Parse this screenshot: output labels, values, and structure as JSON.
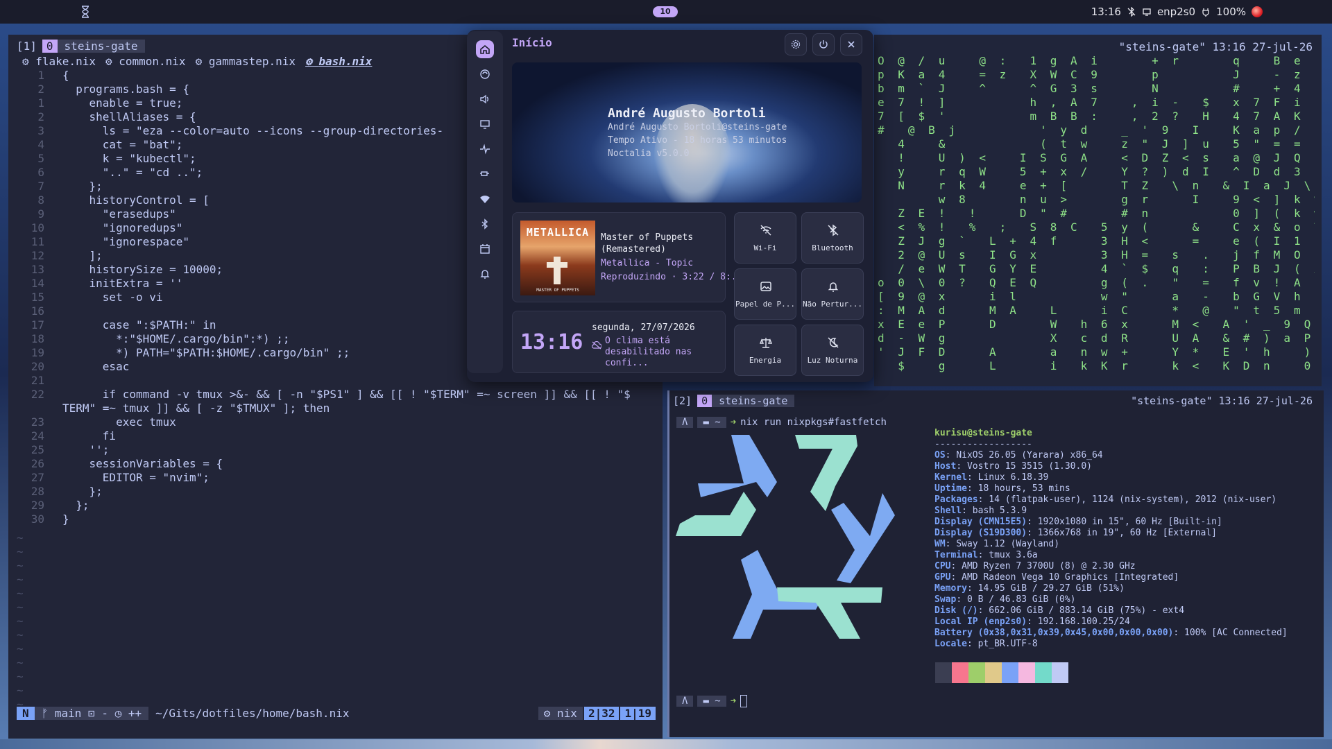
{
  "topbar": {
    "workspace": "10",
    "time": "13:16",
    "network": "enp2s0",
    "battery": "100%"
  },
  "left_pane": {
    "tmux_index": "[1]",
    "tmux_num": "0",
    "tmux_name": "steins-gate",
    "buffers": [
      "flake.nix",
      "common.nix",
      "gammastep.nix",
      "bash.nix"
    ],
    "code": [
      {
        "ln": "1",
        "text": "{"
      },
      {
        "ln": "2",
        "text": "  programs.bash = {"
      },
      {
        "ln": "1",
        "text": "    enable = true;"
      },
      {
        "ln": "2",
        "text": "    shellAliases = {"
      },
      {
        "ln": "3",
        "text": "      ls = \"eza --color=auto --icons --group-directories-"
      },
      {
        "ln": "4",
        "text": "      cat = \"bat\";"
      },
      {
        "ln": "5",
        "text": "      k = \"kubectl\";"
      },
      {
        "ln": "6",
        "text": "      \"..\" = \"cd ..\";"
      },
      {
        "ln": "7",
        "text": "    };"
      },
      {
        "ln": "8",
        "text": "    historyControl = ["
      },
      {
        "ln": "9",
        "text": "      \"erasedups\""
      },
      {
        "ln": "10",
        "text": "      \"ignoredups\""
      },
      {
        "ln": "11",
        "text": "      \"ignorespace\""
      },
      {
        "ln": "12",
        "text": "    ];"
      },
      {
        "ln": "13",
        "text": "    historySize = 10000;"
      },
      {
        "ln": "14",
        "text": "    initExtra = ''"
      },
      {
        "ln": "15",
        "text": "      set -o vi"
      },
      {
        "ln": "16",
        "text": ""
      },
      {
        "ln": "17",
        "text": "      case \":$PATH:\" in"
      },
      {
        "ln": "18",
        "text": "        *:\"$HOME/.cargo/bin\":*) ;;"
      },
      {
        "ln": "19",
        "text": "        *) PATH=\"$PATH:$HOME/.cargo/bin\" ;;"
      },
      {
        "ln": "20",
        "text": "      esac"
      },
      {
        "ln": "21",
        "text": ""
      },
      {
        "ln": "22",
        "text": "      if command -v tmux >&- && [ -n \"$PS1\" ] && [[ ! \"$TERM\" =~ screen ]] && [[ ! \"$"
      },
      {
        "ln": "",
        "text": "TERM\" =~ tmux ]] && [ -z \"$TMUX\" ]; then"
      },
      {
        "ln": "23",
        "text": "        exec tmux"
      },
      {
        "ln": "24",
        "text": "      fi"
      },
      {
        "ln": "25",
        "text": "    '';"
      },
      {
        "ln": "26",
        "text": "    sessionVariables = {"
      },
      {
        "ln": "27",
        "text": "      EDITOR = \"nvim\";"
      },
      {
        "ln": "28",
        "text": "    };"
      },
      {
        "ln": "29",
        "text": "  };"
      },
      {
        "ln": "30",
        "text": "}"
      }
    ],
    "status": {
      "mode": "N",
      "branch": "main",
      "branch_extra": "⊡ - ◷ ++",
      "path": "~/Gits/dotfiles/home/bash.nix",
      "filetype": "nix",
      "pos1": "2|32",
      "pos2": "1|19"
    }
  },
  "top_right": {
    "title": "\"steins-gate\" 13:16 27-jul-26",
    "matrix": [
      "O @ / u   @ :  1 g A i     + r     q   B e",
      "p K a 4   = z  X W C 9     p       J   - z",
      "b m ` J   ^    ^ G 3 s     N       #   + 4",
      "e 7 ! ]        h , A 7   , i -  $  x 7 F i",
      "7 [ $ '        m B B :   , 2 ?  H  4 7 A K",
      "#  @ B j        ' y d   _ ' 9  I   K a p /",
      "  4   &         ( t w   z \" J ] u  5 \" = =",
      "  !   U ) <   I S G A   < D Z < s  a @ J Q u",
      "  y   r q W   5 + x /   Y ? ) d I  ^ D d 3 K &",
      "  N   r k 4   e + [     T Z  \\ n  & I a J \\ o",
      "      w 8     n u >     g r    I   9 < ] k % R",
      "  Z E !  !    D \" #     # n        0 ] ( k w O",
      "  < % !  %  ;  S 8 C  5 y (    &   C x & o T J",
      "  Z J g `  L + 4 f    3 H <    =   e ( I 1 f",
      "  2 @ U s  I G x      3 H =  s  .  j f M O z",
      "  / e W T  G Y E      4 ` $  q  :  P B J ( X Z",
      "o 0 \\ 0 ?  Q E Q      g ( .  \"  =  f v ! A m",
      "[ 9 @ x    i l        w \"    a  -  b G V h u -",
      ": M A d    M A   L    i C    *  @  \" t 5 m F x",
      "x E e P    D     W  h 6 x    M <  A ' _ 9 Q U W",
      "d - W g          X  c d R    U A  & # ) a P *",
      "' J F D    A     a  n w +    Y *  E ' h   )   x",
      "  $   g    L     i  k K r    k <  K D n   0   o"
    ]
  },
  "bottom_right": {
    "tmux_index": "[2]",
    "tmux_num": "0",
    "tmux_name": "steins-gate",
    "title": "\"steins-gate\" 13:16 27-jul-26",
    "prompt_dir": "~",
    "command": "nix run nixpkgs#fastfetch",
    "user_host": "kurisu@steins-gate",
    "divider": "------------------",
    "info": [
      {
        "k": "OS",
        "v": "NixOS 26.05 (Yarara) x86_64"
      },
      {
        "k": "Host",
        "v": "Vostro 15 3515 (1.30.0)"
      },
      {
        "k": "Kernel",
        "v": "Linux 6.18.39"
      },
      {
        "k": "Uptime",
        "v": "18 hours, 53 mins"
      },
      {
        "k": "Packages",
        "v": "14 (flatpak-user), 1124 (nix-system), 2012 (nix-user)"
      },
      {
        "k": "Shell",
        "v": "bash 5.3.9"
      },
      {
        "k": "Display (CMN15E5)",
        "v": "1920x1080 in 15\", 60 Hz [Built-in]"
      },
      {
        "k": "Display (S19D300)",
        "v": "1366x768 in 19\", 60 Hz [External]"
      },
      {
        "k": "WM",
        "v": "Sway 1.12 (Wayland)"
      },
      {
        "k": "Terminal",
        "v": "tmux 3.6a"
      },
      {
        "k": "CPU",
        "v": "AMD Ryzen 7 3700U (8) @ 2.30 GHz"
      },
      {
        "k": "GPU",
        "v": "AMD Radeon Vega 10 Graphics [Integrated]"
      },
      {
        "k": "Memory",
        "v": "14.95 GiB / 29.27 GiB (51%)"
      },
      {
        "k": "Swap",
        "v": "0 B / 46.83 GiB (0%)"
      },
      {
        "k": "Disk (/)",
        "v": "662.06 GiB / 883.14 GiB (75%) - ext4"
      },
      {
        "k": "Local IP (enp2s0)",
        "v": "192.168.100.25/24"
      },
      {
        "k": "Battery (0x38,0x31,0x39,0x45,0x00,0x00,0x00)",
        "v": "100% [AC Connected]"
      },
      {
        "k": "Locale",
        "v": "pt_BR.UTF-8"
      }
    ],
    "swatches": [
      "#3b3e52",
      "#f7768e",
      "#9ece6a",
      "#e0c98a",
      "#7aa2f7",
      "#f5b8e0",
      "#73daca",
      "#c0caf5"
    ]
  },
  "panel": {
    "heading": "Início",
    "profile_name": "André Augusto Bortoli",
    "profile_user": "André Augusto Bortoli@steins-gate",
    "profile_uptime": "Tempo Ativo - 18 horas 53 minutos",
    "profile_version": "Noctalia v5.0.0",
    "music_art_band": "METALLICA",
    "music_art_album": "MASTER OF PUPPETS",
    "music_title": "Master of Puppets (Remastered)",
    "music_artist": "Metallica - Topic",
    "music_status": "Reproduzindo · 3:22 / 8:...",
    "clock": "13:16",
    "date": "segunda, 27/07/2026",
    "weather": "O clima está desabilitado nas confi...",
    "tiles": {
      "wifi": "Wi-Fi",
      "bluetooth": "Bluetooth",
      "wallpaper": "Papel de P...",
      "dnd": "Não Pertur...",
      "energy": "Energia",
      "nightlight": "Luz Noturna"
    }
  }
}
